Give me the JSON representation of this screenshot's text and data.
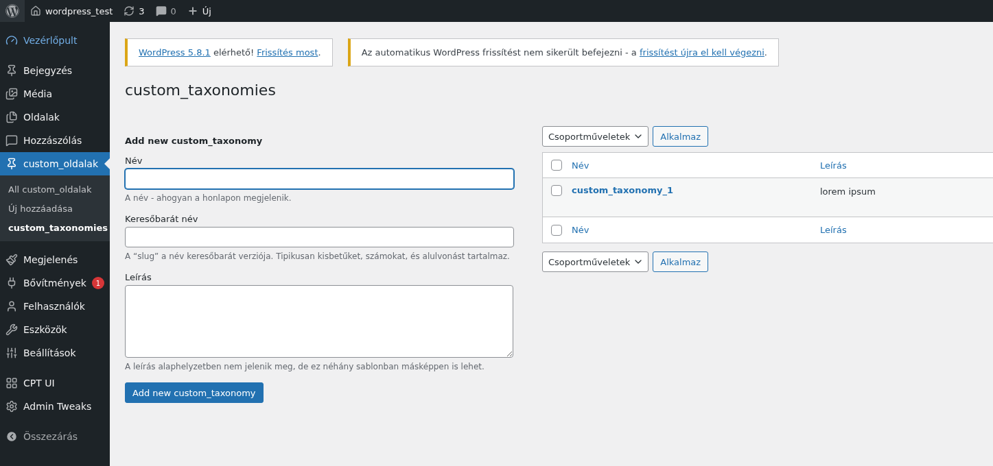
{
  "admin_bar": {
    "site": "wordpress_test",
    "updates": "3",
    "comments": "0",
    "new": "Új"
  },
  "sidebar": {
    "groups": [
      [
        {
          "label": "Vezérlőpult",
          "selected": false,
          "hovered": true
        }
      ],
      [
        {
          "label": "Bejegyzés",
          "selected": false,
          "hovered": false
        },
        {
          "label": "Média",
          "selected": false,
          "hovered": false
        },
        {
          "label": "Oldalak",
          "selected": false,
          "hovered": false
        },
        {
          "label": "Hozzászólás",
          "selected": false,
          "hovered": false
        },
        {
          "label": "custom_oldalak",
          "selected": true,
          "hovered": false,
          "children": [
            {
              "label": "All custom_oldalak",
              "selected": false
            },
            {
              "label": "Új hozzáadása",
              "selected": false
            },
            {
              "label": "custom_taxonomies",
              "selected": true
            }
          ]
        }
      ],
      [
        {
          "label": "Megjelenés",
          "selected": false,
          "hovered": false
        },
        {
          "label": "Bővítmények",
          "selected": false,
          "hovered": false,
          "badge": "1"
        },
        {
          "label": "Felhasználók",
          "selected": false,
          "hovered": false
        },
        {
          "label": "Eszközök",
          "selected": false,
          "hovered": false
        },
        {
          "label": "Beállítások",
          "selected": false,
          "hovered": false
        }
      ],
      [
        {
          "label": "CPT UI",
          "selected": false,
          "hovered": false
        },
        {
          "label": "Admin Tweaks",
          "selected": false,
          "hovered": false
        }
      ]
    ],
    "collapse": "Összezárás"
  },
  "notices": [
    [
      {
        "text": "WordPress 5.8.1",
        "link": true
      },
      {
        "text": " elérhető! ",
        "link": false
      },
      {
        "text": "Frissítés most",
        "link": true
      },
      {
        "text": ".",
        "link": false
      }
    ],
    [
      {
        "text": "Az automatikus WordPress frissítést nem sikerült befejezni - a ",
        "link": false
      },
      {
        "text": "frissítést újra el kell végezni",
        "link": true
      },
      {
        "text": ".",
        "link": false
      }
    ]
  ],
  "page_title": "custom_taxonomies",
  "form": {
    "heading": "Add new custom_taxonomy",
    "fields": [
      {
        "kind": "input",
        "label": "Név",
        "focused": true,
        "hint": "A név - ahogyan a honlapon megjelenik."
      },
      {
        "kind": "input",
        "label": "Keresőbarát név",
        "focused": false,
        "hint": "A “slug” a név keresőbarát verziója. Tipikusan kisbetűket, számokat, és alulvonást tartalmaz."
      },
      {
        "kind": "textarea",
        "label": "Leírás",
        "focused": false,
        "hint": "A leírás alaphelyzetben nem jelenik meg, de ez néhány sablonban másképpen is lehet."
      }
    ],
    "submit": "Add new custom_taxonomy"
  },
  "table": {
    "bulk_action": "Csoportműveletek",
    "apply": "Alkalmaz",
    "columns": [
      {
        "label": "Név",
        "checked": false
      },
      {
        "label": "Leírás"
      }
    ],
    "rows": [
      {
        "name": "custom_taxonomy_1",
        "description": "lorem ipsum",
        "checked": false
      }
    ],
    "footer": [
      {
        "label": "Név",
        "checked": false
      },
      {
        "label": "Leírás"
      }
    ],
    "bulk_action_bottom": "Csoportműveletek",
    "apply_bottom": "Alkalmaz"
  }
}
